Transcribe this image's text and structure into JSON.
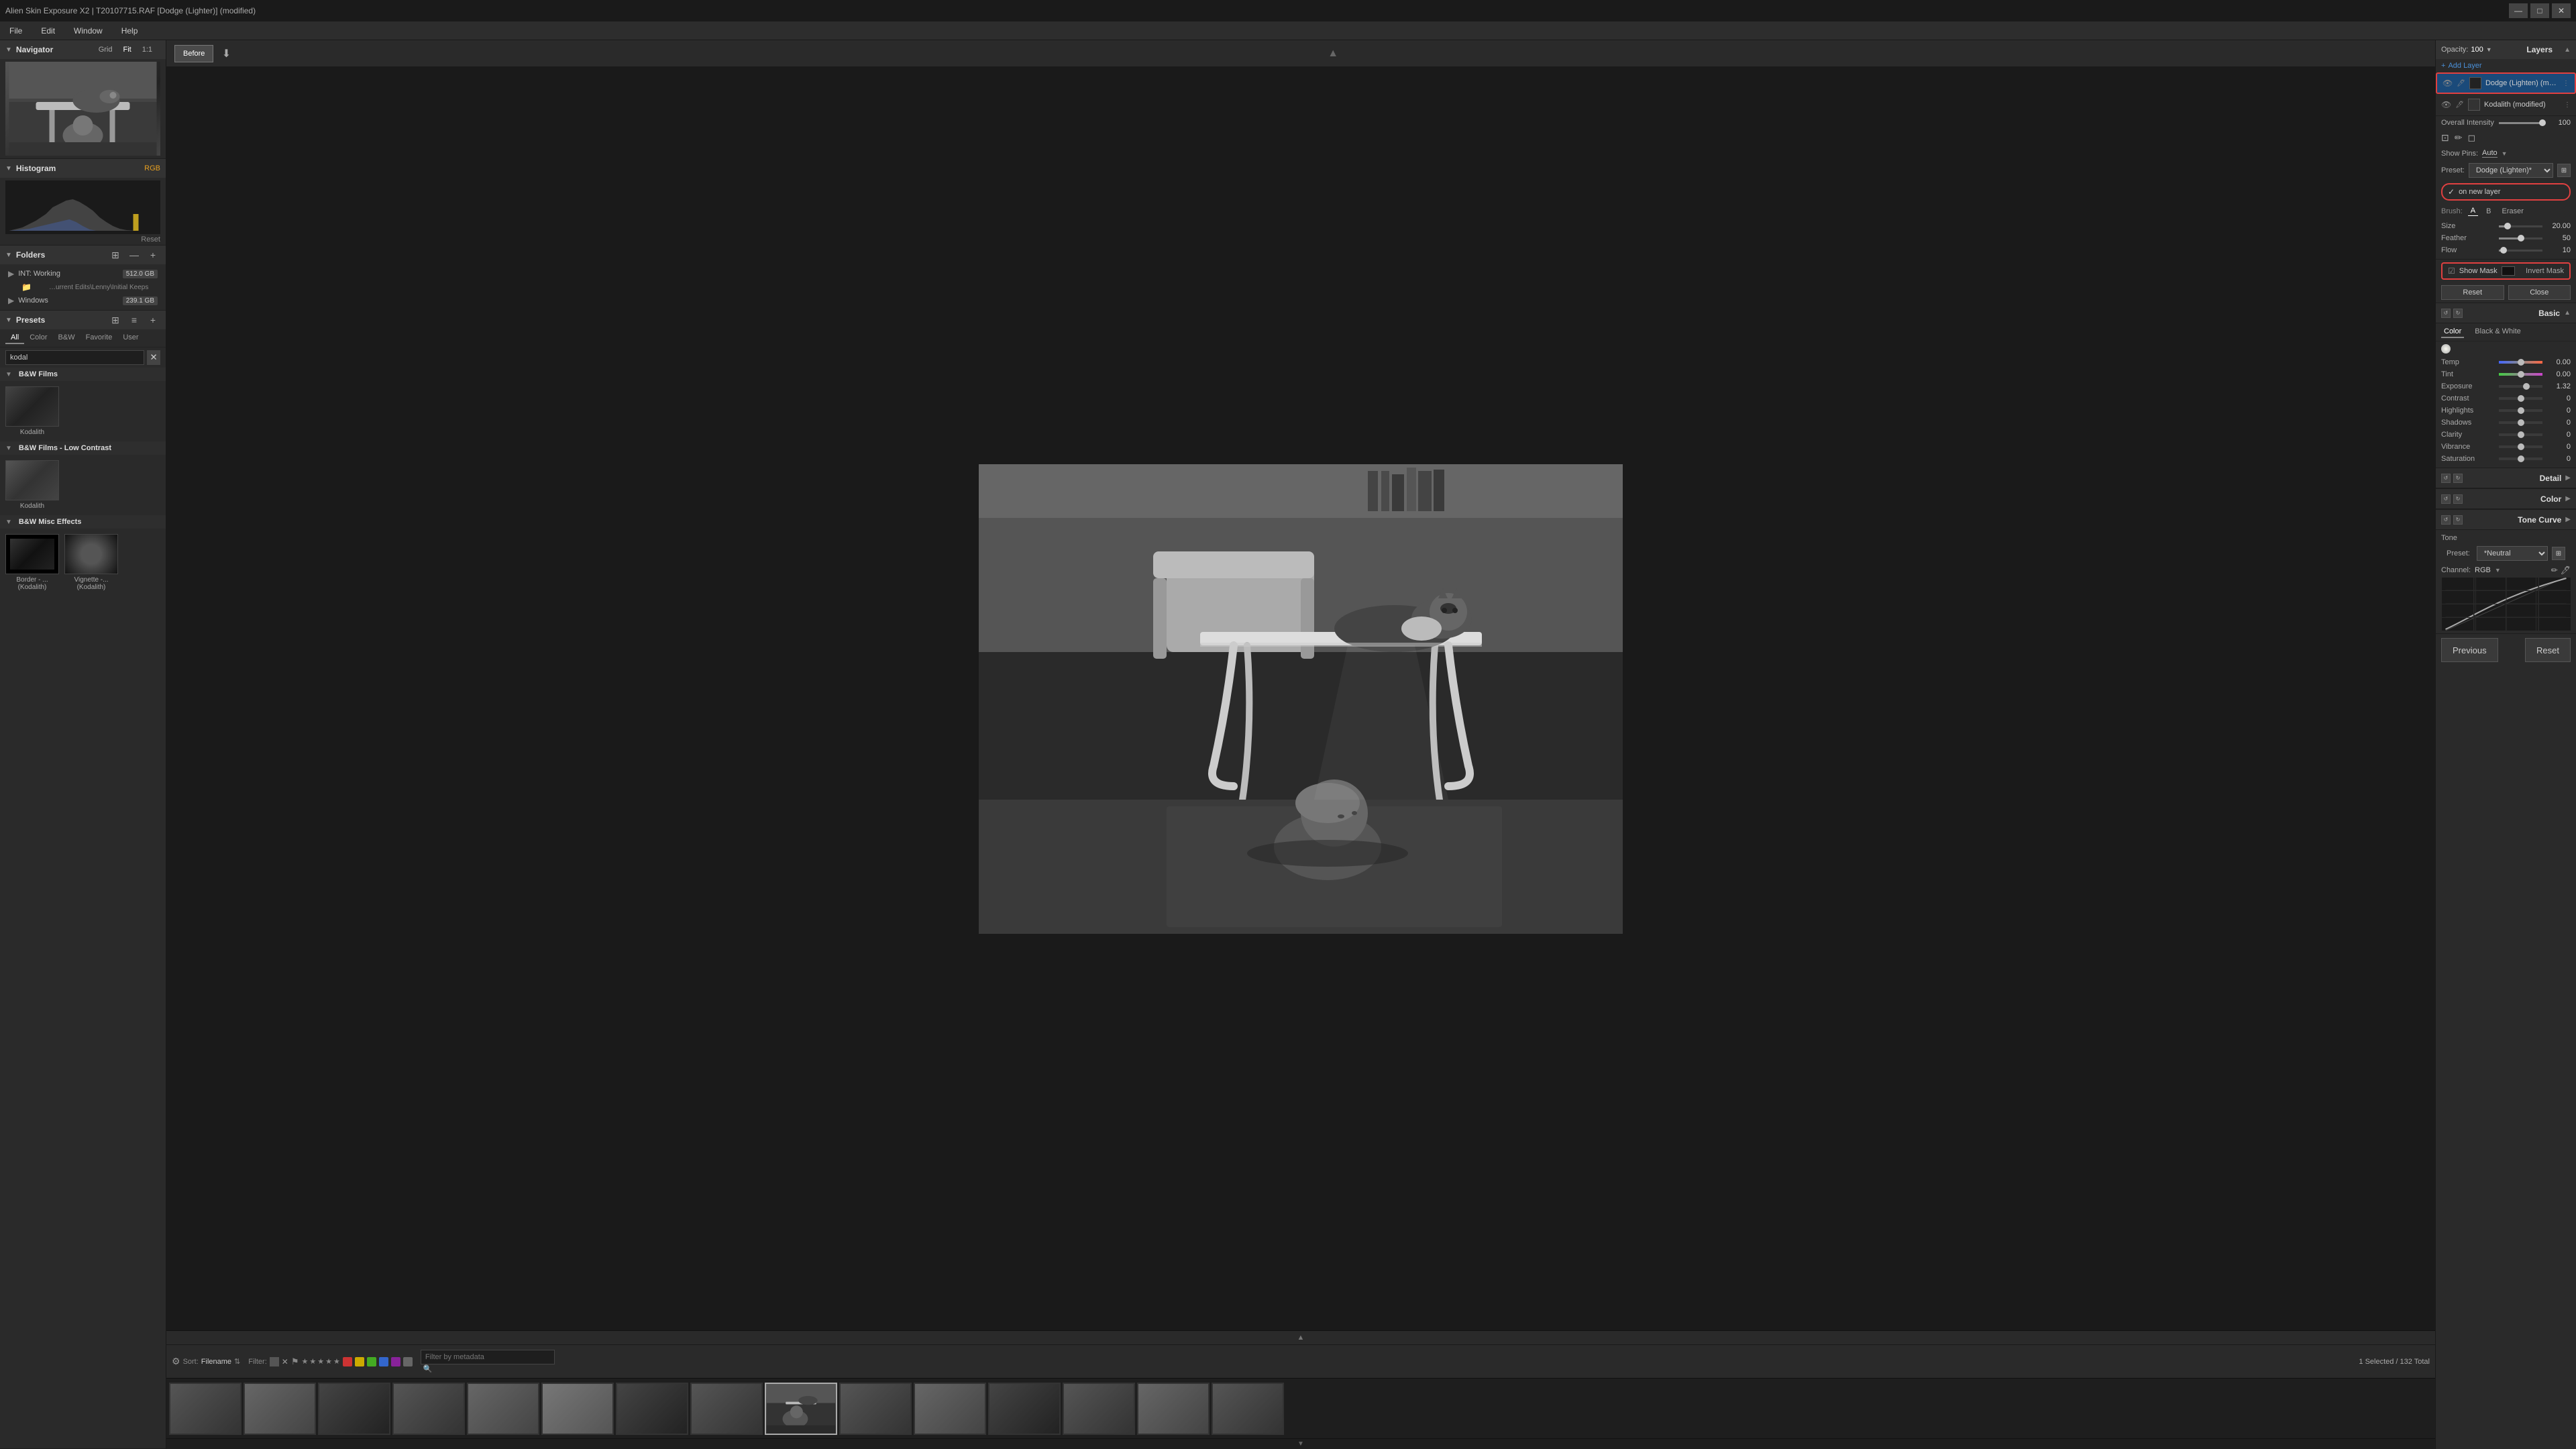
{
  "titleBar": {
    "title": "Alien Skin Exposure X2 | T20107715.RAF [Dodge (Lighter)] (modified)",
    "controls": [
      "—",
      "□",
      "✕"
    ]
  },
  "menuBar": {
    "items": [
      "File",
      "Edit",
      "Window",
      "Help"
    ]
  },
  "navigator": {
    "title": "Navigator",
    "controls": [
      "Grid",
      "Fit",
      "1:1"
    ]
  },
  "histogram": {
    "title": "Histogram",
    "rgbLabel": "RGB",
    "resetLabel": "Reset"
  },
  "folders": {
    "title": "Folders",
    "items": [
      {
        "label": "INT: Working",
        "size": "512.0 GB",
        "type": "drive"
      },
      {
        "label": "…urrent Edits\\Lenny\\Initial Keeps",
        "size": "",
        "type": "folder"
      },
      {
        "label": "Windows",
        "size": "239.1 GB",
        "type": "drive"
      }
    ]
  },
  "presets": {
    "title": "Presets",
    "tabs": [
      "All",
      "Color",
      "B&W",
      "Favorite",
      "User"
    ],
    "searchPlaceholder": "kodal",
    "groups": [
      {
        "name": "B&W Films",
        "items": [
          {
            "name": "Kodalith"
          }
        ]
      },
      {
        "name": "B&W Films - Low Contrast",
        "items": [
          {
            "name": "Kodalith"
          }
        ]
      },
      {
        "name": "B&W Misc Effects",
        "items": [
          {
            "name": "Border - ...(Kodalith)"
          },
          {
            "name": "Vignette -...(Kodalith)"
          }
        ]
      }
    ]
  },
  "toolbar": {
    "beforeLabel": "Before",
    "arrowLabel": "↓"
  },
  "layers": {
    "title": "Layers",
    "opacityLabel": "Opacity:",
    "opacityValue": "100",
    "addLayerLabel": "Add Layer",
    "items": [
      {
        "name": "Dodge (Lighten) (mod...",
        "selected": true
      },
      {
        "name": "Kodalith (modified)",
        "selected": false
      }
    ]
  },
  "brushPanel": {
    "showPinsLabel": "Show Pins:",
    "showPinsValue": "Auto",
    "presetLabel": "Preset:",
    "presetValue": "Dodge (Lighten)*",
    "onNewLayerLabel": "on new layer",
    "brushLabel": "Brush:",
    "brushTabs": [
      "A",
      "B",
      "Eraser"
    ],
    "size": {
      "label": "Size",
      "value": "20.00",
      "percent": 20
    },
    "feather": {
      "label": "Feather",
      "value": "50",
      "percent": 50
    },
    "flow": {
      "label": "Flow",
      "value": "10",
      "percent": 10
    },
    "overallIntensityLabel": "Overall Intensity",
    "overallIntensityValue": "100",
    "showMaskLabel": "Show Mask",
    "invertMaskLabel": "Invert Mask",
    "resetLabel": "Reset",
    "closeLabel": "Close"
  },
  "basicPanel": {
    "title": "Basic",
    "colorTab": "Color",
    "bwTab": "Black & White",
    "tempLabel": "Temp",
    "tempValue": "0.00",
    "tintLabel": "Tint",
    "tintValue": "0.00",
    "exposureLabel": "Exposure",
    "exposureValue": "1.32",
    "contrastLabel": "Contrast",
    "contrastValue": "0",
    "highlightsLabel": "Highlights",
    "highlightsValue": "0",
    "shadowsLabel": "Shadows",
    "shadowsValue": "0",
    "clarityLabel": "Clarity",
    "clarityValue": "0",
    "vibranceLabel": "Vibrance",
    "vibranceValue": "0",
    "saturationLabel": "Saturation",
    "saturationValue": "0"
  },
  "detailPanel": {
    "title": "Detail"
  },
  "colorPanel2": {
    "title": "Color"
  },
  "toneCurvePanel": {
    "title": "Tone Curve",
    "toneLabel": "Tone",
    "presetLabel": "Preset:",
    "presetValue": "*Neutral",
    "channelLabel": "Channel:",
    "channelValue": "RGB"
  },
  "filmstrip": {
    "sortLabel": "Sort:",
    "sortValue": "Filename",
    "filterLabel": "Filter:",
    "searchPlaceholder": "Filter by metadata",
    "count": "1 Selected / 132 Total",
    "selectedCount": "Selected 132 Total"
  },
  "bottomNav": {
    "previousLabel": "Previous",
    "resetLabel": "Reset"
  },
  "filmstripColors": [
    "#e04040",
    "#f0c030",
    "#60b040",
    "#4080e0",
    "#9040c0",
    "#666"
  ],
  "sliderColors": {
    "temp": "#4488ff",
    "tint": "#cc44cc",
    "exposure": "#aaaaaa",
    "neutral": "#888888"
  }
}
